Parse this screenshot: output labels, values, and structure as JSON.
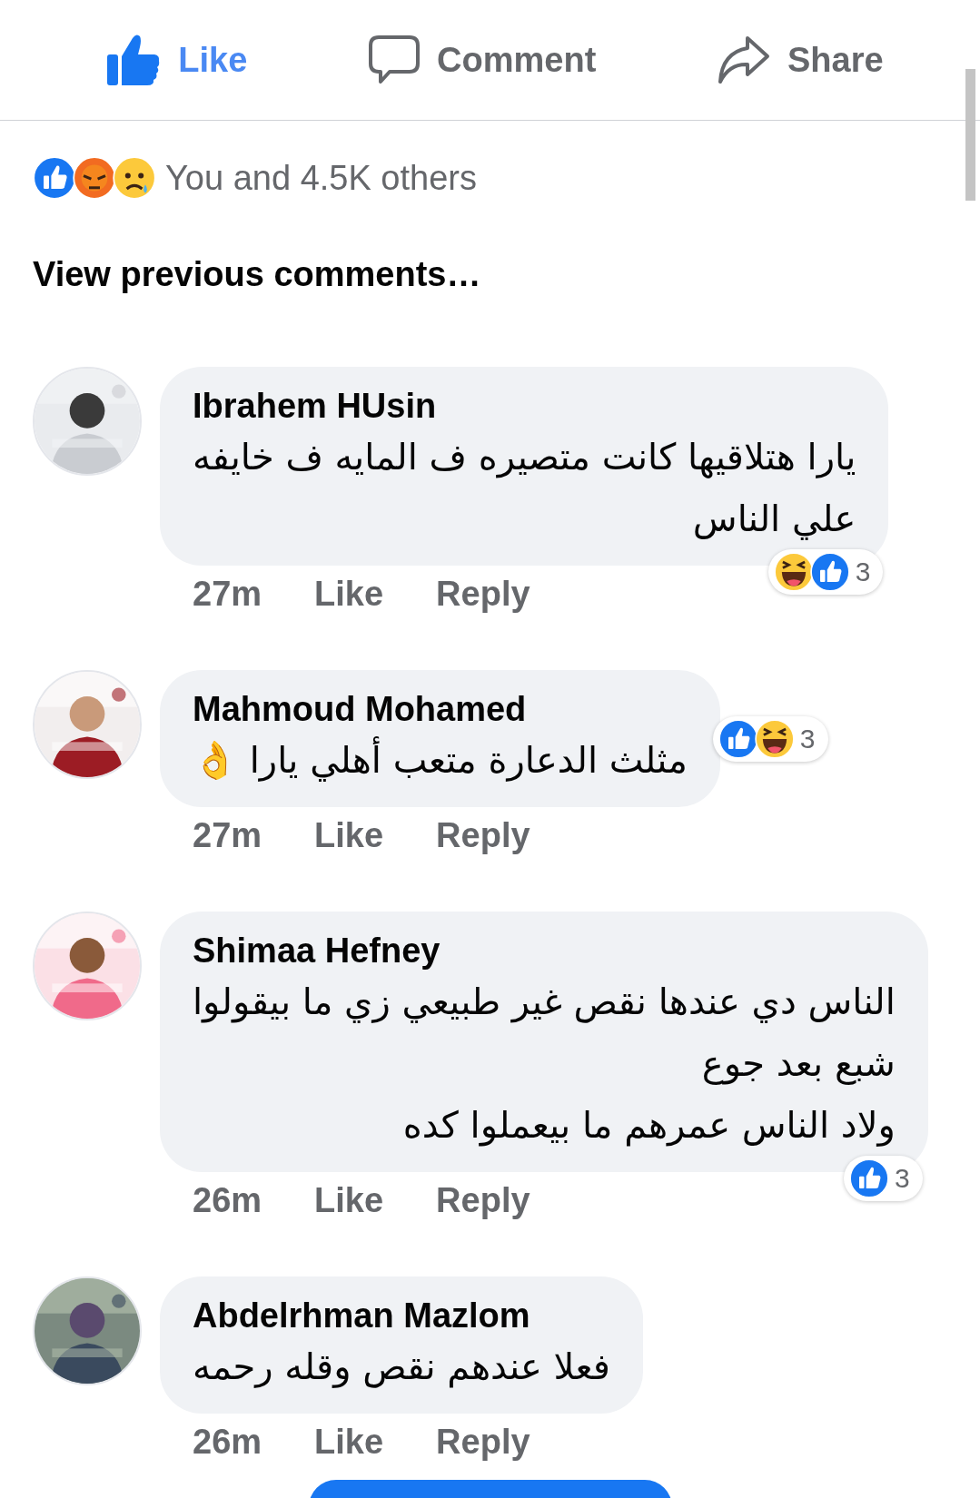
{
  "actions": [
    {
      "kind": "like",
      "label": "Like",
      "selected": true
    },
    {
      "kind": "comment",
      "label": "Comment",
      "selected": false
    },
    {
      "kind": "share",
      "label": "Share",
      "selected": false
    }
  ],
  "reaction_summary": {
    "reactions": [
      {
        "kind": "like"
      },
      {
        "kind": "angry"
      },
      {
        "kind": "sad"
      }
    ],
    "text": "You and 4.5K others"
  },
  "view_previous": "View previous comments…",
  "comments": [
    {
      "name": "Ibrahem HUsin",
      "lines": [
        "يارا هتلاقيها كانت متصيره ف المايه ف خايفه",
        "علي الناس"
      ],
      "time": "27m",
      "like": "Like",
      "reply": "Reply",
      "reaction_badge": {
        "kind": "corner",
        "reactions": [
          {
            "kind": "haha"
          },
          {
            "kind": "like"
          }
        ],
        "count": "3"
      }
    },
    {
      "name": "Mahmoud Mohamed",
      "lines": [
        "مثلث الدعارة متعب أهلي يارا 👌"
      ],
      "time": "27m",
      "like": "Like",
      "reply": "Reply",
      "reaction_badge": {
        "kind": "side",
        "reactions": [
          {
            "kind": "like"
          },
          {
            "kind": "haha"
          }
        ],
        "count": "3"
      }
    },
    {
      "name": "Shimaa Hefney",
      "lines": [
        "الناس دي عندها نقص غير طبيعي زي ما بيقولوا",
        "شبع بعد جوع",
        "ولاد الناس عمرهم ما بيعملوا كده"
      ],
      "time": "26m",
      "like": "Like",
      "reply": "Reply",
      "reaction_badge": {
        "kind": "corner",
        "reactions": [
          {
            "kind": "like"
          }
        ],
        "count": "3"
      }
    },
    {
      "name": "Abdelrhman Mazlom",
      "lines": [
        "فعلا عندهم نقص وقله رحمه"
      ],
      "time": "26m",
      "like": "Like",
      "reply": "Reply"
    }
  ]
}
